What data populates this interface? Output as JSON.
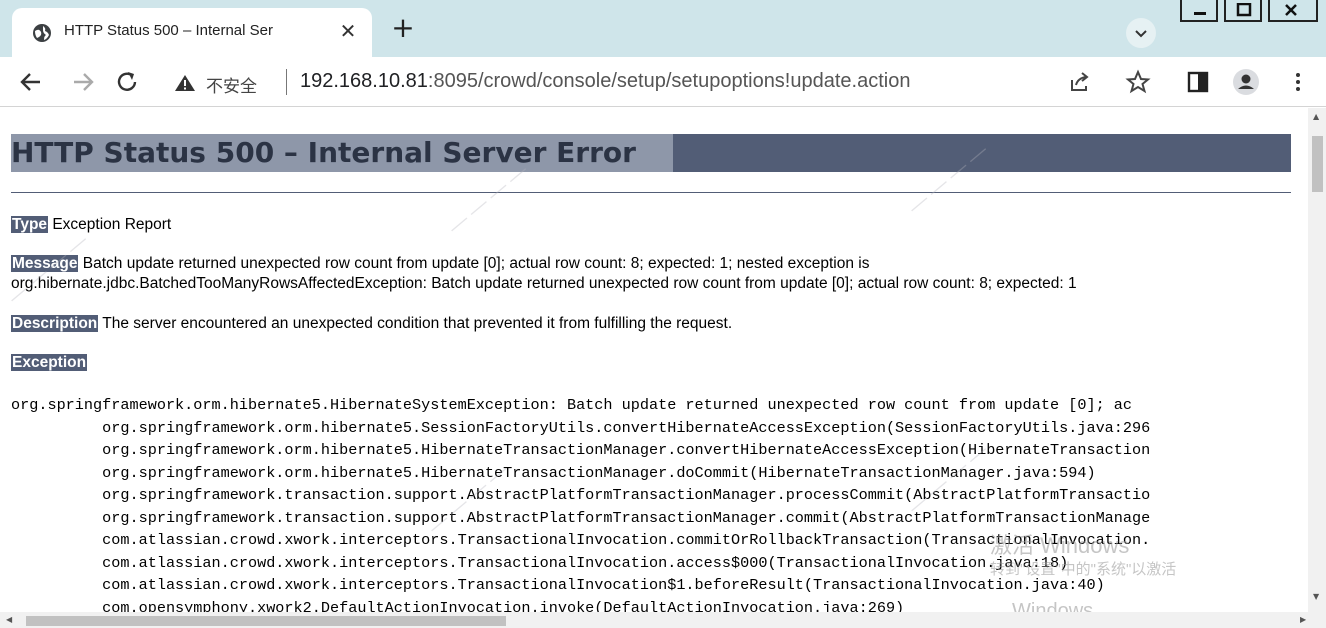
{
  "browser": {
    "tab_title": "HTTP Status 500 – Internal Ser",
    "tab_close": "✕",
    "new_tab": "+",
    "insecure_label": "不安全",
    "url_host": "192.168.10.81",
    "url_rest": ":8095/crowd/console/setup/setupoptions!update.action"
  },
  "page": {
    "title": "HTTP Status 500 – Internal Server Error",
    "type_label": "Type",
    "type_value": "Exception Report",
    "message_label": "Message",
    "message_value_1": "Batch update returned unexpected row count from update [0]; actual row count: 8; expected: 1; nested exception is",
    "message_value_2": "org.hibernate.jdbc.BatchedTooManyRowsAffectedException: Batch update returned unexpected row count from update [0]; actual row count: 8; expected: 1",
    "description_label": "Description",
    "description_value": "The server encountered an unexpected condition that prevented it from fulfilling the request.",
    "exception_label": "Exception",
    "trace": "org.springframework.orm.hibernate5.HibernateSystemException: Batch update returned unexpected row count from update [0]; ac\n\torg.springframework.orm.hibernate5.SessionFactoryUtils.convertHibernateAccessException(SessionFactoryUtils.java:296\n\torg.springframework.orm.hibernate5.HibernateTransactionManager.convertHibernateAccessException(HibernateTransaction\n\torg.springframework.orm.hibernate5.HibernateTransactionManager.doCommit(HibernateTransactionManager.java:594)\n\torg.springframework.transaction.support.AbstractPlatformTransactionManager.processCommit(AbstractPlatformTransactio\n\torg.springframework.transaction.support.AbstractPlatformTransactionManager.commit(AbstractPlatformTransactionManage\n\tcom.atlassian.crowd.xwork.interceptors.TransactionalInvocation.commitOrRollbackTransaction(TransactionalInvocation.\n\tcom.atlassian.crowd.xwork.interceptors.TransactionalInvocation.access$000(TransactionalInvocation.java:18)\n\tcom.atlassian.crowd.xwork.interceptors.TransactionalInvocation$1.beforeResult(TransactionalInvocation.java:40)\n\tcom.opensymphony.xwork2.DefaultActionInvocation.invoke(DefaultActionInvocation.java:269)"
  },
  "overlay": {
    "activate_title": "激活 Windows",
    "activate_sub": "转到\"设置\"中的\"系统\"以激活",
    "activate_sub2": "Windows。"
  },
  "colors": {
    "tabstrip": "#cfe5ea",
    "heading_bg": "#525d76"
  }
}
